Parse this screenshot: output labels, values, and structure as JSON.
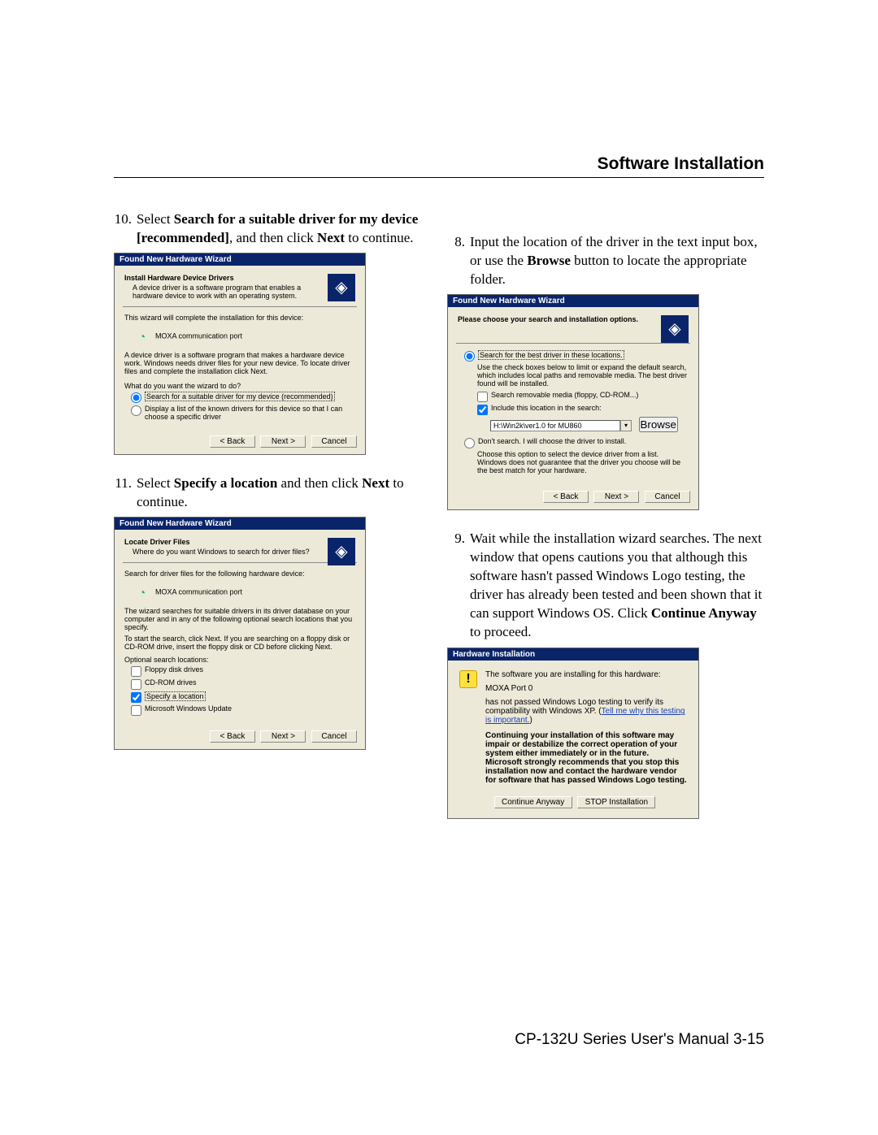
{
  "header": {
    "title": "Software Installation"
  },
  "footer": {
    "text": "CP-132U Series User's Manual 3-15"
  },
  "steps": {
    "s10": {
      "num": "10.",
      "pre": "Select ",
      "b1": "Search for a suitable driver for my device [recommended]",
      "mid": ", and then click ",
      "b2": "Next",
      "post": " to continue."
    },
    "s11": {
      "num": "11.",
      "pre": "Select ",
      "b1": "Specify a location",
      "mid": " and then click ",
      "b2": "Next",
      "post": " to continue."
    },
    "s8": {
      "num": "8.",
      "pre": "Input the location of the driver in the text input box, or use the ",
      "b1": "Browse",
      "post": " button to locate the appropriate folder."
    },
    "s9": {
      "num": "9.",
      "pre": "Wait while the installation wizard searches. The next window that opens cautions you that although this software hasn't passed Windows Logo testing, the driver has already been tested and been shown that it can support Windows OS. Click ",
      "b1": "Continue Anyway",
      "post": " to proceed."
    }
  },
  "dlg1": {
    "title": "Found New Hardware Wizard",
    "heading": "Install Hardware Device Drivers",
    "sub": "A device driver is a software program that enables a hardware device to work with an operating system.",
    "line1": "This wizard will complete the installation for this device:",
    "device": "MOXA communication port",
    "para": "A device driver is a software program that makes a hardware device work. Windows needs driver files for your new device. To locate driver files and complete the installation click Next.",
    "q": "What do you want the wizard to do?",
    "opt1": "Search for a suitable driver for my device (recommended)",
    "opt2": "Display a list of the known drivers for this device so that I can choose a specific driver",
    "back": "< Back",
    "next": "Next >",
    "cancel": "Cancel"
  },
  "dlg2": {
    "title": "Found New Hardware Wizard",
    "heading": "Locate Driver Files",
    "sub": "Where do you want Windows to search for driver files?",
    "line1": "Search for driver files for the following hardware device:",
    "device": "MOXA communication port",
    "para1": "The wizard searches for suitable drivers in its driver database on your computer and in any of the following optional search locations that you specify.",
    "para2": "To start the search, click Next. If you are searching on a floppy disk or CD-ROM drive, insert the floppy disk or CD before clicking Next.",
    "optlabel": "Optional search locations:",
    "c1": "Floppy disk drives",
    "c2": "CD-ROM drives",
    "c3": "Specify a location",
    "c4": "Microsoft Windows Update",
    "back": "< Back",
    "next": "Next >",
    "cancel": "Cancel"
  },
  "dlg3": {
    "title": "Found New Hardware Wizard",
    "heading": "Please choose your search and installation options.",
    "opt1": "Search for the best driver in these locations.",
    "opt1desc": "Use the check boxes below to limit or expand the default search, which includes local paths and removable media. The best driver found will be installed.",
    "c1": "Search removable media (floppy, CD-ROM...)",
    "c2": "Include this location in the search:",
    "path": "H:\\Win2k\\ver1.0 for MU860",
    "browse": "Browse",
    "opt2": "Don't search. I will choose the driver to install.",
    "opt2desc": "Choose this option to select the device driver from a list. Windows does not guarantee that the driver you choose will be the best match for your hardware.",
    "back": "< Back",
    "next": "Next >",
    "cancel": "Cancel"
  },
  "dlg4": {
    "title": "Hardware Installation",
    "l1": "The software you are installing for this hardware:",
    "l2": "MOXA Port 0",
    "l3a": "has not passed Windows Logo testing to verify its compatibility with Windows XP. (",
    "link": "Tell me why this testing is important.",
    "l3b": ")",
    "warn": "Continuing your installation of this software may impair or destabilize the correct operation of your system either immediately or in the future. Microsoft strongly recommends that you stop this installation now and contact the hardware vendor for software that has passed Windows Logo testing.",
    "btn1": "Continue Anyway",
    "btn2": "STOP Installation"
  }
}
